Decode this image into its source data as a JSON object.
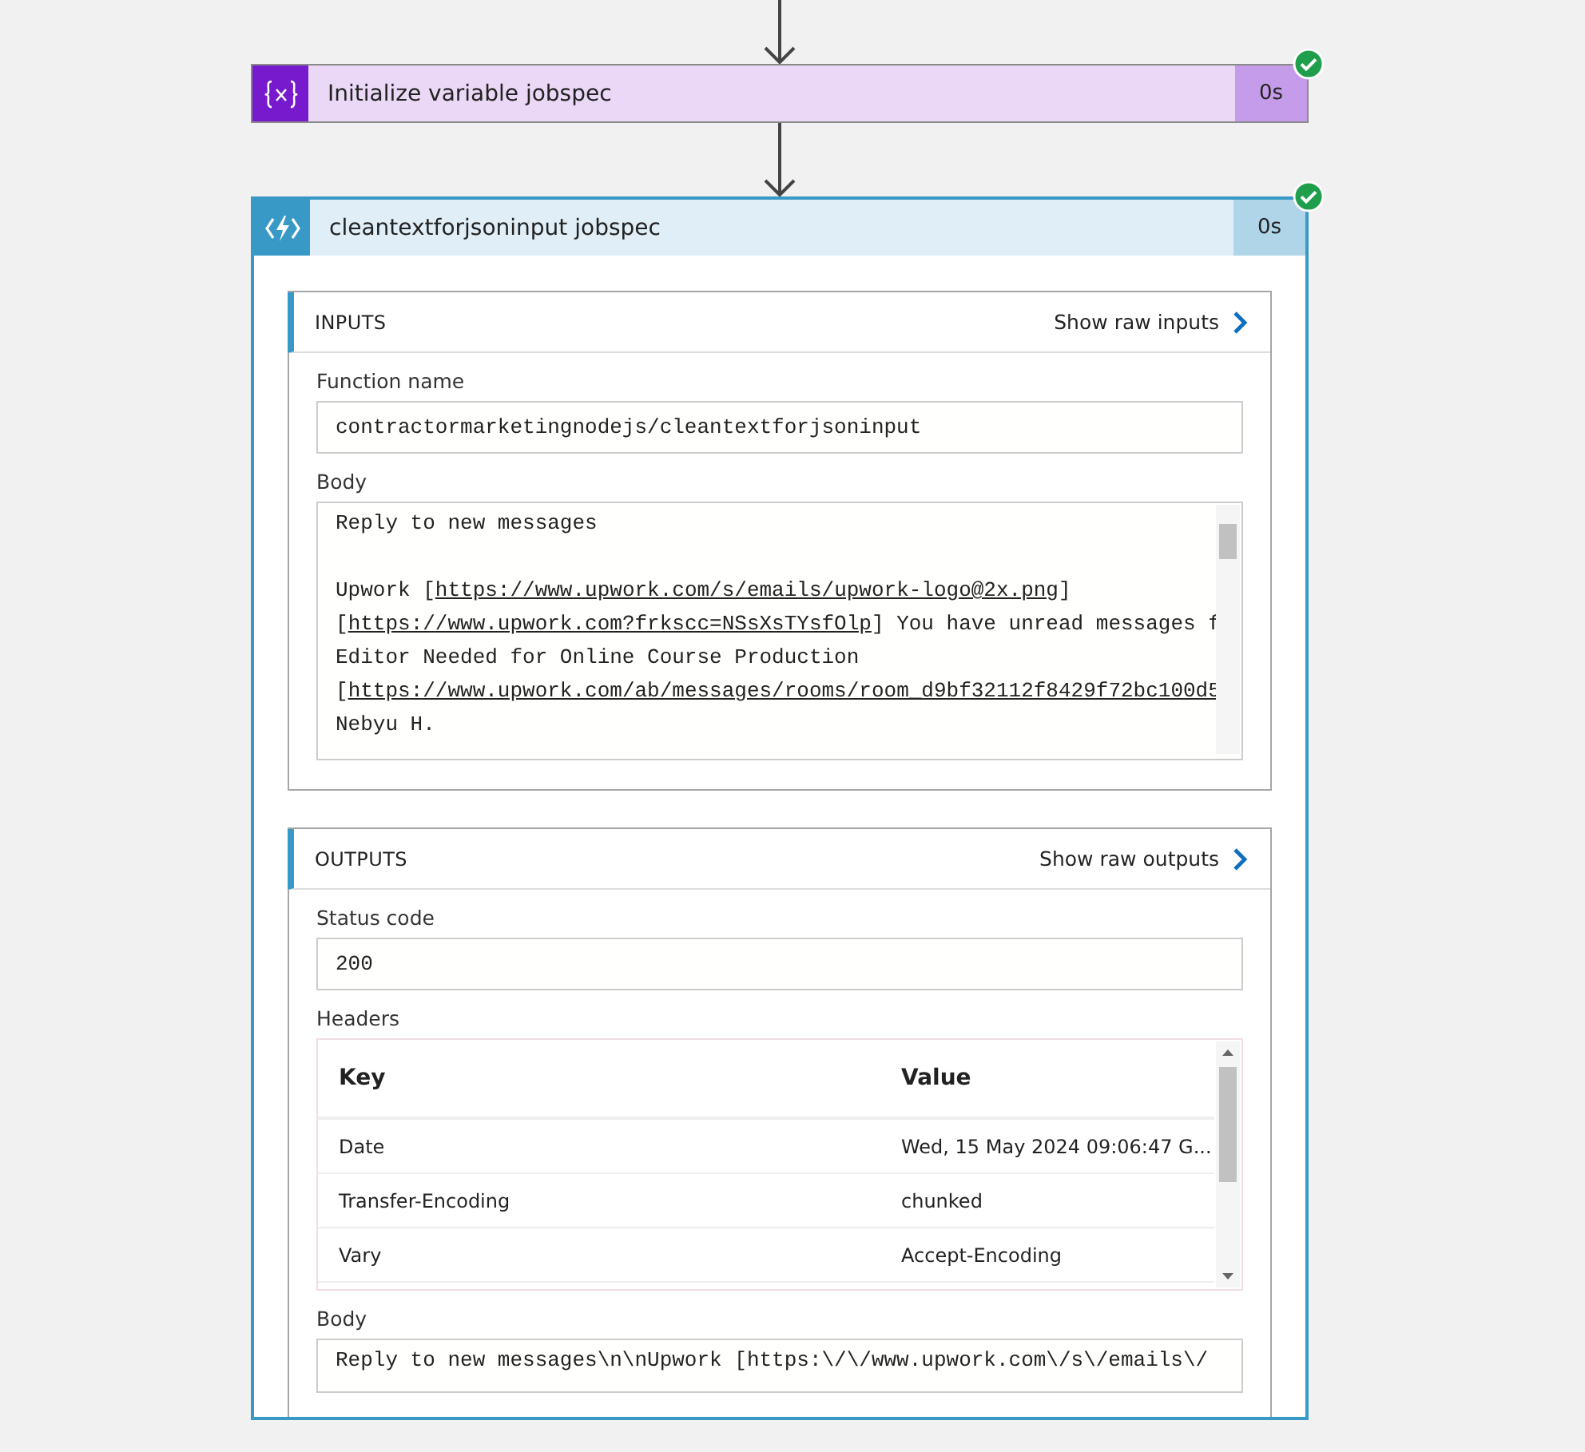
{
  "steps": [
    {
      "kind": "variable",
      "title": "Initialize variable jobspec",
      "duration": "0s",
      "succeeded": true,
      "selected": false
    },
    {
      "kind": "function",
      "title": "cleantextforjsoninput jobspec",
      "duration": "0s",
      "succeeded": true,
      "selected": true,
      "inputs": {
        "heading": "INPUTS",
        "raw_link": "Show raw inputs",
        "fields": [
          {
            "kind": "text",
            "label": "Function name",
            "value": "contractormarketingnodejs/cleantextforjsoninput"
          },
          {
            "kind": "code",
            "label": "Body",
            "lines": [
              {
                "kind": "text",
                "segments": [
                  {
                    "kind": "plain",
                    "text": "Reply to new messages"
                  }
                ]
              },
              {
                "kind": "blank"
              },
              {
                "kind": "text",
                "segments": [
                  {
                    "kind": "plain",
                    "text": "Upwork ["
                  },
                  {
                    "kind": "link",
                    "text": "https://www.upwork.com/s/emails/upwork-logo@2x.png"
                  },
                  {
                    "kind": "plain",
                    "text": "]"
                  }
                ]
              },
              {
                "kind": "text",
                "segments": [
                  {
                    "kind": "plain",
                    "text": "["
                  },
                  {
                    "kind": "link",
                    "text": "https://www.upwork.com?frkscc=NSsXsTYsfOlp"
                  },
                  {
                    "kind": "plain",
                    "text": "] You have unread messages f"
                  }
                ]
              },
              {
                "kind": "text",
                "segments": [
                  {
                    "kind": "plain",
                    "text": "Editor Needed for Online Course Production"
                  }
                ]
              },
              {
                "kind": "text",
                "segments": [
                  {
                    "kind": "plain",
                    "text": "["
                  },
                  {
                    "kind": "link",
                    "text": "https://www.upwork.com/ab/messages/rooms/room_d9bf32112f8429f72bc100d5"
                  }
                ]
              },
              {
                "kind": "text",
                "segments": [
                  {
                    "kind": "plain",
                    "text": "Nebyu H."
                  }
                ]
              }
            ]
          }
        ]
      },
      "outputs": {
        "heading": "OUTPUTS",
        "raw_link": "Show raw outputs",
        "fields": [
          {
            "kind": "text",
            "label": "Status code",
            "value": "200"
          },
          {
            "kind": "table",
            "label": "Headers",
            "columns": [
              "Key",
              "Value"
            ],
            "rows": [
              [
                "Date",
                "Wed, 15 May 2024 09:06:47 G..."
              ],
              [
                "Transfer-Encoding",
                "chunked"
              ],
              [
                "Vary",
                "Accept-Encoding"
              ]
            ]
          },
          {
            "kind": "code",
            "label": "Body",
            "lines": [
              {
                "kind": "text",
                "segments": [
                  {
                    "kind": "plain",
                    "text": "Reply to new messages\\n\\nUpwork [https:\\/\\/www.upwork.com\\/s\\/emails\\/"
                  }
                ]
              }
            ]
          }
        ]
      }
    }
  ]
}
